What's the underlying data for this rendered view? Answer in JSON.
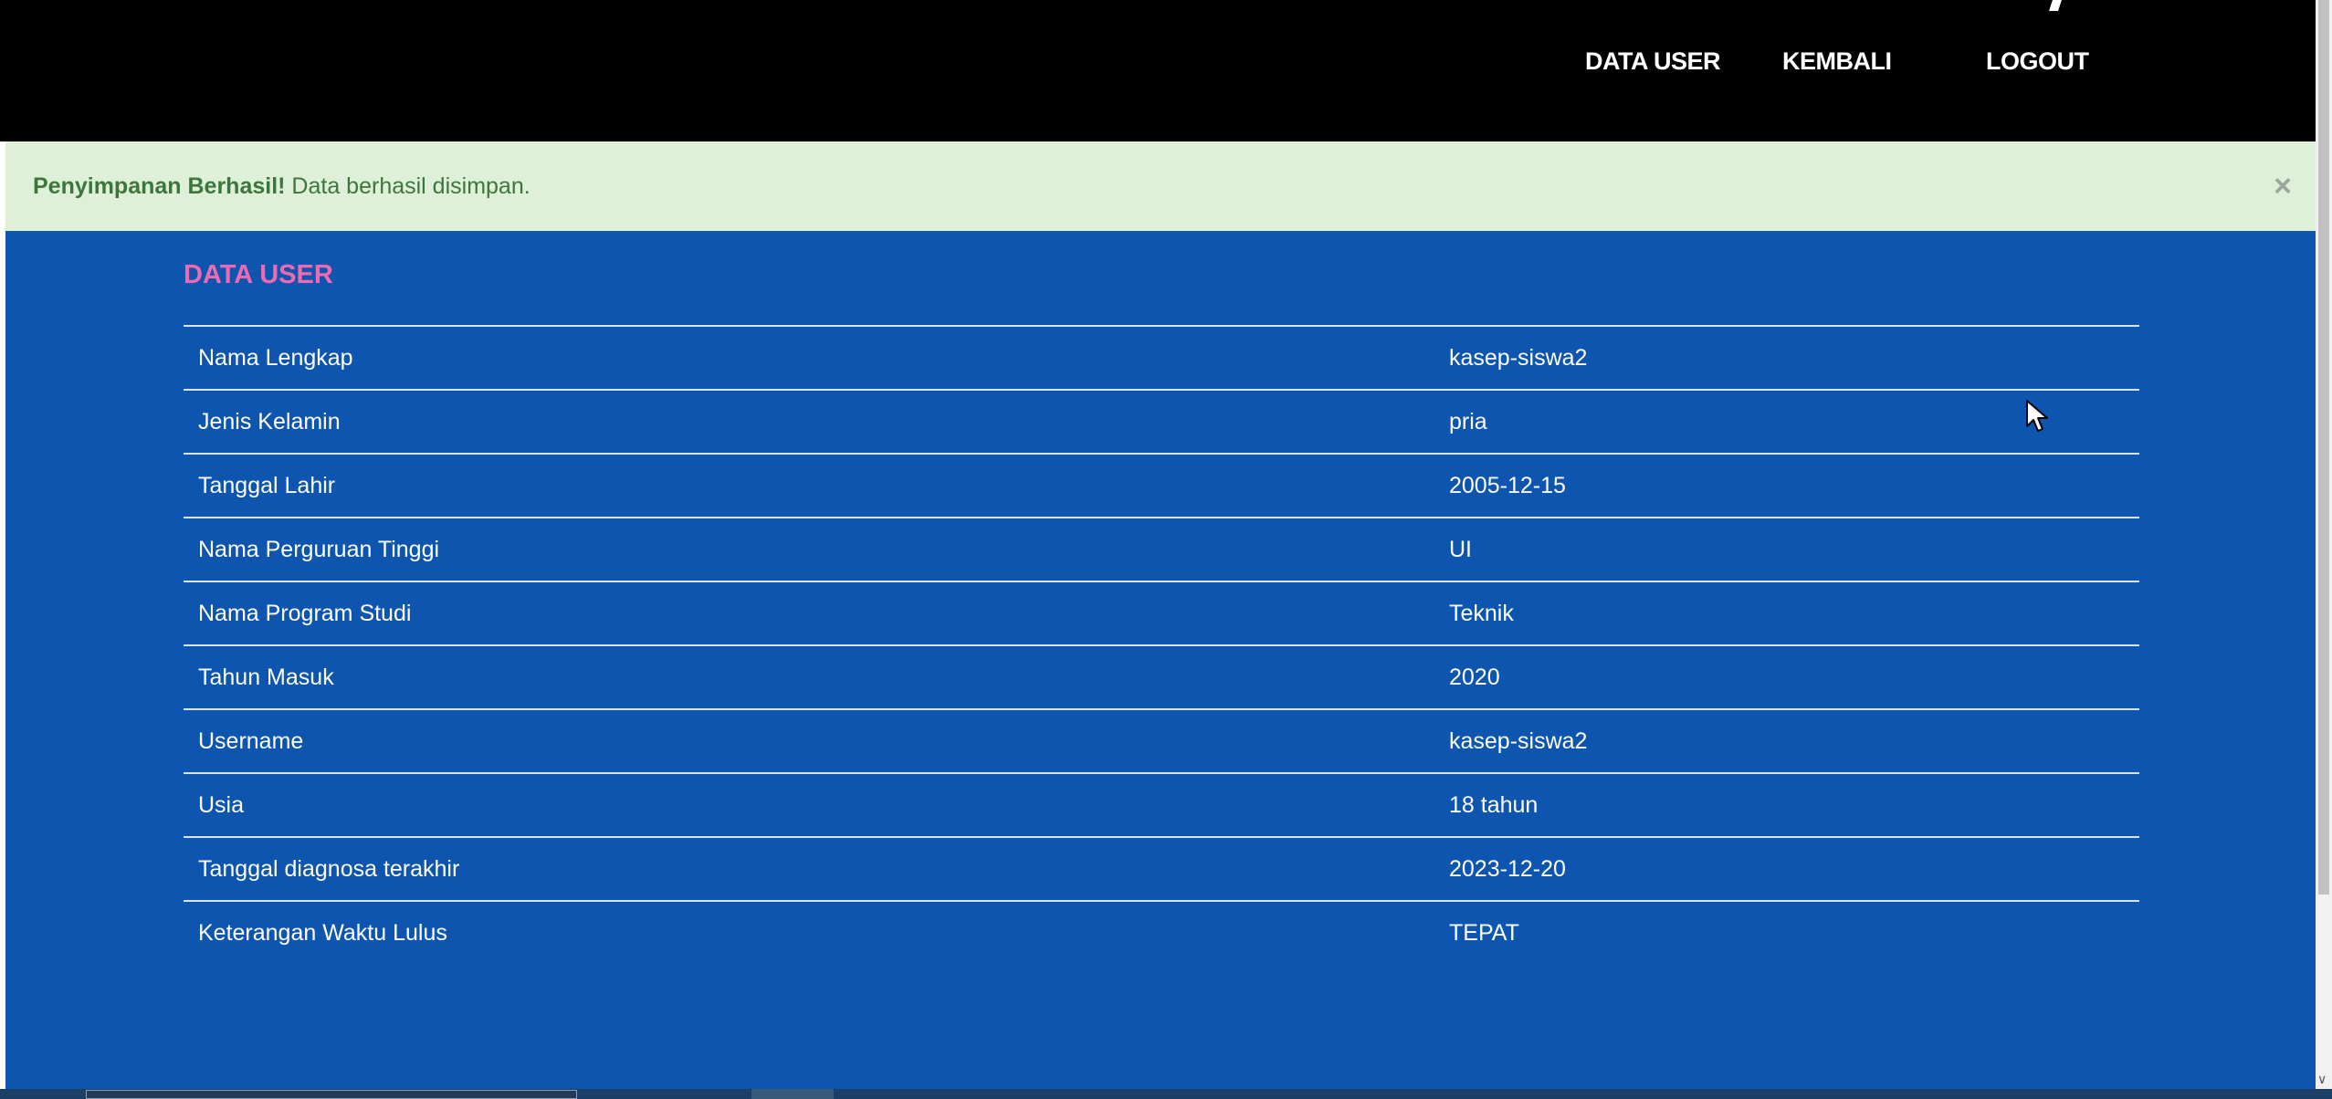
{
  "nav": {
    "items": [
      {
        "label": "DATA USER"
      },
      {
        "label": "KEMBALI"
      },
      {
        "label": "LOGOUT"
      }
    ]
  },
  "alert": {
    "strong": "Penyimpanan Berhasil!",
    "message": " Data berhasil disimpan.",
    "close": "×"
  },
  "section": {
    "title": "DATA USER"
  },
  "user_table": {
    "rows": [
      {
        "label": "Nama Lengkap",
        "value": "kasep-siswa2"
      },
      {
        "label": "Jenis Kelamin",
        "value": "pria"
      },
      {
        "label": "Tanggal Lahir",
        "value": "2005-12-15"
      },
      {
        "label": "Nama Perguruan Tinggi",
        "value": "UI"
      },
      {
        "label": "Nama Program Studi",
        "value": "Teknik"
      },
      {
        "label": "Tahun Masuk",
        "value": "2020"
      },
      {
        "label": "Username",
        "value": "kasep-siswa2"
      },
      {
        "label": "Usia",
        "value": "18 tahun"
      },
      {
        "label": "Tanggal diagnosa terakhir",
        "value": "2023-12-20"
      },
      {
        "label": "Keterangan Waktu Lulus",
        "value": "TEPAT"
      }
    ]
  },
  "scrollbar": {
    "arrow_icon": "chevron-down-icon"
  },
  "colors": {
    "navbar": "#000000",
    "alert_bg": "#dff0d8",
    "alert_text": "#3c763d",
    "content_bg": "#0d55ae",
    "title_pink": "#f06ab1"
  }
}
